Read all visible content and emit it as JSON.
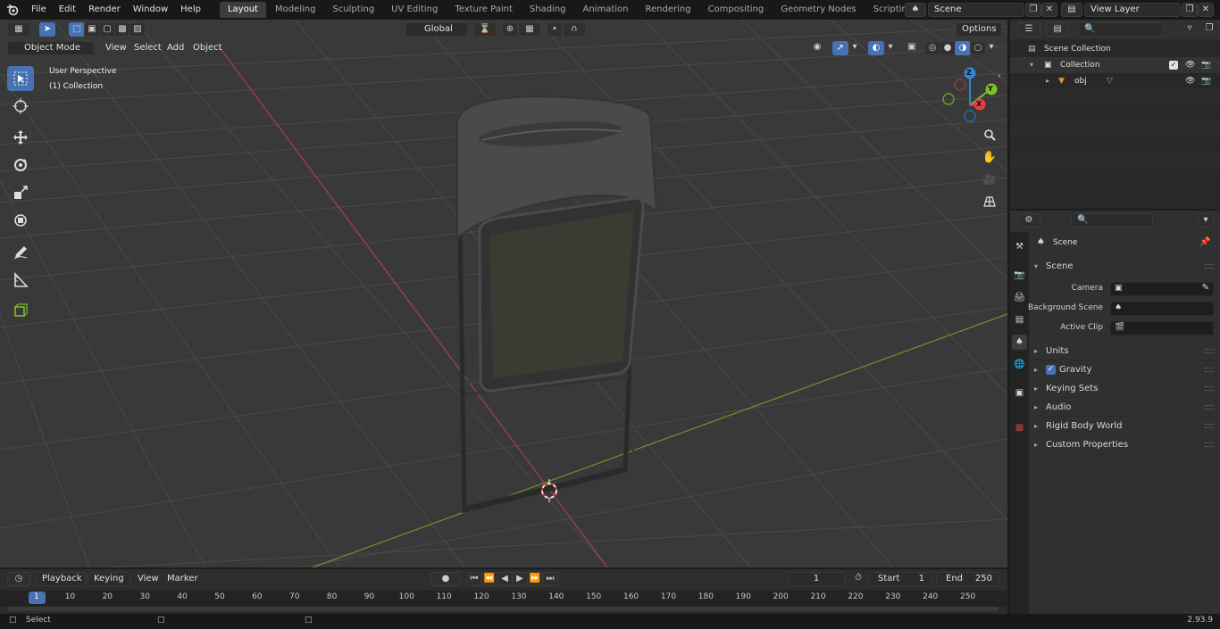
{
  "topbar": {
    "menu": [
      "File",
      "Edit",
      "Render",
      "Window",
      "Help"
    ],
    "workspaces": [
      "Layout",
      "Modeling",
      "Sculpting",
      "UV Editing",
      "Texture Paint",
      "Shading",
      "Animation",
      "Rendering",
      "Compositing",
      "Geometry Nodes",
      "Scripting"
    ],
    "active_workspace": "Layout",
    "add_tab": "+",
    "scene_name": "Scene",
    "view_layer": "View Layer"
  },
  "viewport": {
    "mode": "Object Mode",
    "menu": [
      "View",
      "Select",
      "Add",
      "Object"
    ],
    "transform_orientation": "Global",
    "options_label": "Options",
    "overlay_title": "User Perspective",
    "overlay_subtitle": "(1) Collection",
    "gizmo": {
      "z": "Z",
      "y": "Y",
      "x": "X"
    }
  },
  "outliner": {
    "rows": [
      {
        "label": "Scene Collection"
      },
      {
        "label": "Collection"
      },
      {
        "label": "obj"
      }
    ]
  },
  "properties": {
    "header": "Scene",
    "section": "Scene",
    "fields": [
      {
        "label": "Camera"
      },
      {
        "label": "Background Scene"
      },
      {
        "label": "Active Clip"
      }
    ],
    "panels": [
      "Units",
      "Gravity",
      "Keying Sets",
      "Audio",
      "Rigid Body World",
      "Custom Properties"
    ],
    "gravity_checked": true
  },
  "timeline": {
    "menu": [
      "Playback",
      "Keying",
      "View",
      "Marker"
    ],
    "current_frame": "1",
    "start_label": "Start",
    "start_value": "1",
    "end_label": "End",
    "end_value": "250",
    "ticks": [
      "1",
      "10",
      "20",
      "30",
      "40",
      "50",
      "60",
      "70",
      "80",
      "90",
      "100",
      "110",
      "120",
      "130",
      "140",
      "150",
      "160",
      "170",
      "180",
      "190",
      "200",
      "210",
      "220",
      "230",
      "240",
      "250"
    ]
  },
  "statusbar": {
    "select_label": "Select",
    "version": "2.93.9"
  },
  "colors": {
    "accent": "#4772b3",
    "x_axis": "#e0404a",
    "y_axis": "#7fbf2a",
    "z_axis": "#2f86d8"
  }
}
